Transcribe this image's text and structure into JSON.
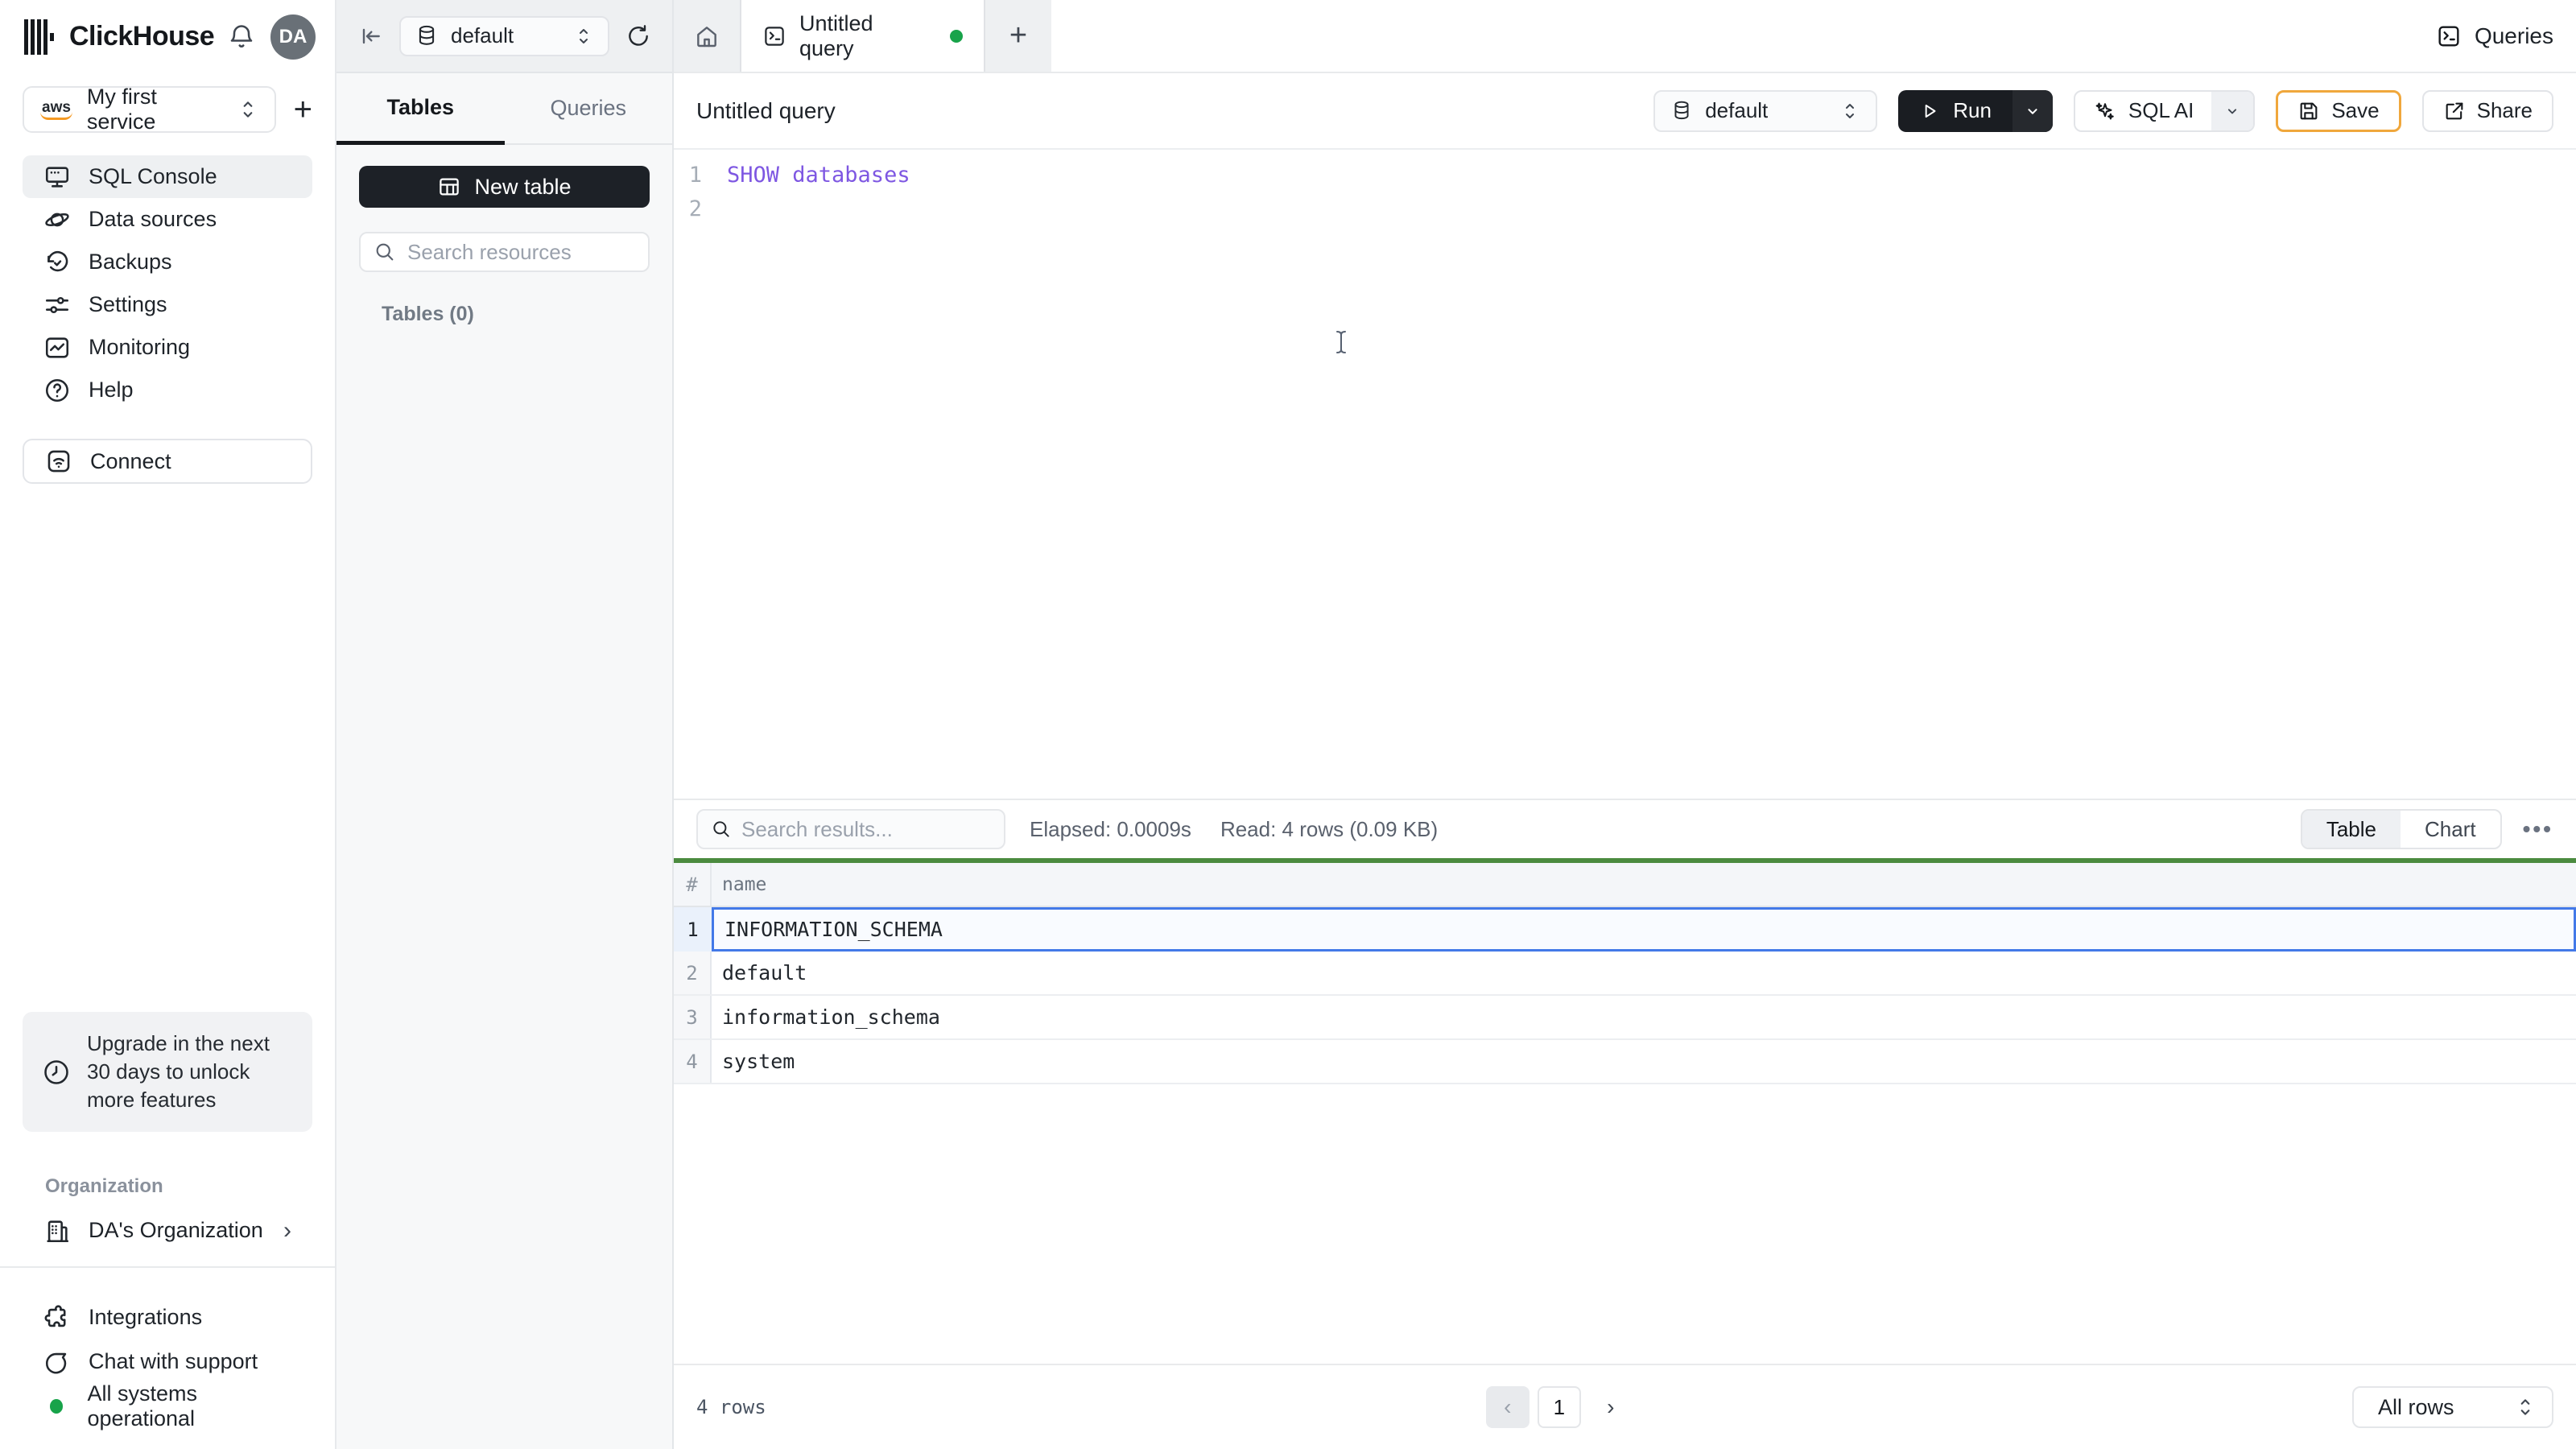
{
  "topbar": {
    "brand": "ClickHouse",
    "avatar_initials": "DA",
    "db_selector_value": "default",
    "tab_title": "Untitled query",
    "new_tab_plus": "+",
    "queries_label": "Queries"
  },
  "sidebar": {
    "service_selector": {
      "provider": "aws",
      "name": "My first service"
    },
    "add_service_plus": "+",
    "nav": [
      {
        "label": "SQL Console"
      },
      {
        "label": "Data sources"
      },
      {
        "label": "Backups"
      },
      {
        "label": "Settings"
      },
      {
        "label": "Monitoring"
      },
      {
        "label": "Help"
      }
    ],
    "connect_label": "Connect",
    "upgrade_notice": "Upgrade in the next 30 days to unlock more features",
    "organization_section_label": "Organization",
    "organization_name": "DA's Organization",
    "organization_chevron": "›",
    "footer_links": [
      {
        "label": "Integrations"
      },
      {
        "label": "Chat with support"
      },
      {
        "label": "All systems operational"
      }
    ]
  },
  "explorer": {
    "tabs": [
      {
        "label": "Tables"
      },
      {
        "label": "Queries"
      }
    ],
    "new_table_label": "New table",
    "search_placeholder": "Search resources",
    "section_label": "Tables (0)"
  },
  "query_editor": {
    "title": "Untitled query",
    "database": "default",
    "run_label": "Run",
    "sql_ai_label": "SQL AI",
    "save_label": "Save",
    "share_label": "Share",
    "lines": [
      {
        "number": "1",
        "code": "SHOW databases"
      },
      {
        "number": "2",
        "code": ""
      }
    ]
  },
  "results": {
    "search_placeholder": "Search results...",
    "elapsed": "Elapsed: 0.0009s",
    "read": "Read: 4 rows (0.09 KB)",
    "view_toggle": [
      {
        "label": "Table"
      },
      {
        "label": "Chart"
      }
    ],
    "more_label": "•••",
    "table": {
      "columns": [
        "#",
        "name"
      ],
      "rows": [
        {
          "num": "1",
          "name": "INFORMATION_SCHEMA",
          "selected": true
        },
        {
          "num": "2",
          "name": "default"
        },
        {
          "num": "3",
          "name": "information_schema"
        },
        {
          "num": "4",
          "name": "system"
        }
      ]
    },
    "footer": {
      "row_count": "4 rows",
      "prev": "‹",
      "page": "1",
      "next": "›",
      "page_size": "All rows"
    }
  },
  "colors": {
    "sql_keyword_purple": "#7e57e2",
    "selection_blue": "#4379e8",
    "results_bar_green": "#4b8b3f",
    "status_green": "#18a34a",
    "save_highlight_orange": "#f0a73c",
    "dark_button": "#1d2127"
  }
}
